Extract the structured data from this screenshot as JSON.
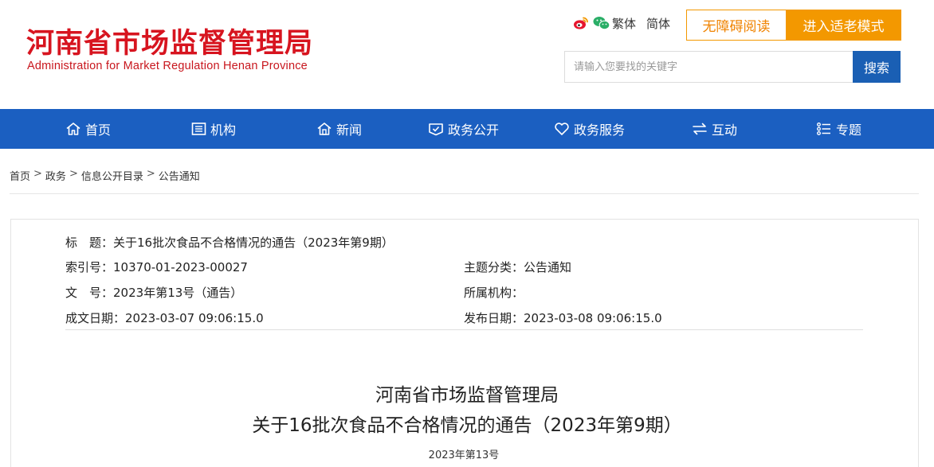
{
  "header": {
    "logo_cn": "河南省市场监督管理局",
    "logo_en": "Administration for Market Regulation Henan Province",
    "lang_traditional": "繁体",
    "lang_simplified": "简体",
    "accessibility_label": "无障碍阅读",
    "elder_mode_label": "进入适老模式",
    "search_placeholder": "请输入您要找的关键字",
    "search_button": "搜索"
  },
  "nav": {
    "items": [
      {
        "label": "首页",
        "icon": "home-icon"
      },
      {
        "label": "机构",
        "icon": "org-icon"
      },
      {
        "label": "新闻",
        "icon": "news-icon"
      },
      {
        "label": "政务公开",
        "icon": "open-gov-icon"
      },
      {
        "label": "政务服务",
        "icon": "heart-icon"
      },
      {
        "label": "互动",
        "icon": "exchange-icon"
      },
      {
        "label": "专题",
        "icon": "topics-icon"
      }
    ]
  },
  "breadcrumb": {
    "items": [
      "首页",
      "政务",
      "信息公开目录",
      "公告通知"
    ],
    "separator": ">"
  },
  "meta": {
    "title_label": "标　题：",
    "title_value": "关于16批次食品不合格情况的通告（2023年第9期）",
    "index_label": "索引号：",
    "index_value": "10370-01-2023-00027",
    "topic_label": "主题分类：",
    "topic_value": "公告通知",
    "docno_label": "文　号：",
    "docno_value": "2023年第13号（通告）",
    "org_label": "所属机构：",
    "org_value": "",
    "created_label": "成文日期：",
    "created_value": "2023-03-07 09:06:15.0",
    "published_label": "发布日期：",
    "published_value": "2023-03-08 09:06:15.0"
  },
  "article": {
    "title_line1": "河南省市场监督管理局",
    "title_line2": "关于16批次食品不合格情况的通告（2023年第9期）",
    "doc_number": "2023年第13号"
  },
  "colors": {
    "brand_red": "#d7141f",
    "nav_blue": "#1b5fc1",
    "accent_orange": "#f39800",
    "search_blue": "#1a5fb4"
  }
}
